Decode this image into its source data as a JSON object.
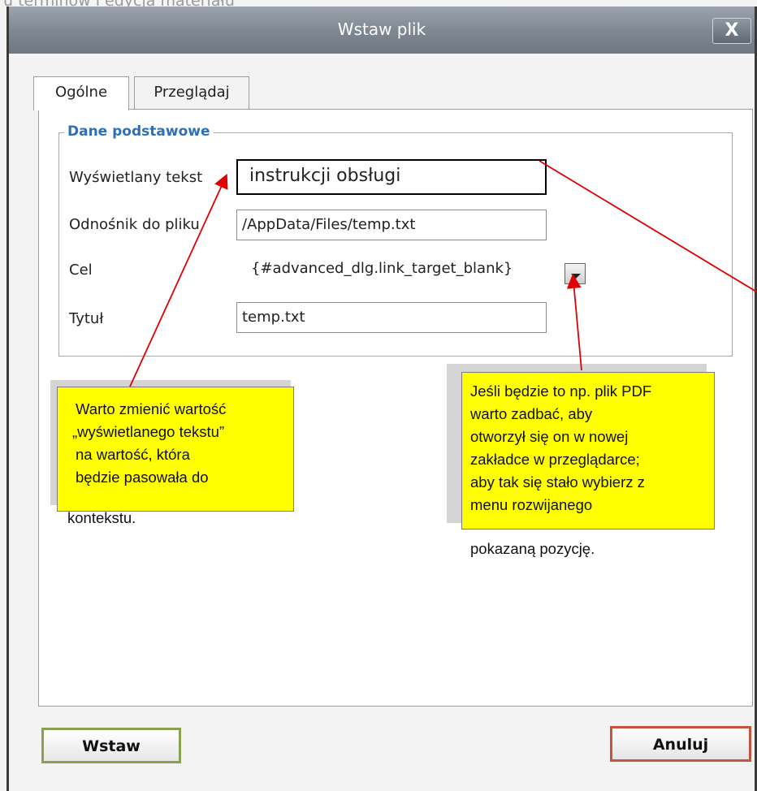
{
  "background": {
    "text": "u terminów i edycja materiału"
  },
  "dialog": {
    "title": "Wstaw plik",
    "close_label": "X",
    "tabs": [
      {
        "label": "Ogólne"
      },
      {
        "label": "Przeglądaj"
      }
    ],
    "fieldset": {
      "legend": "Dane podstawowe",
      "fields": {
        "display_text": {
          "label": "Wyświetlany tekst",
          "value": "instrukcji obsługi"
        },
        "file_link": {
          "label": "Odnośnik do pliku",
          "value": "/AppData/Files/temp.txt"
        },
        "target": {
          "label": "Cel",
          "value": "{#advanced_dlg.link_target_blank}"
        },
        "title": {
          "label": "Tytuł",
          "value": "temp.txt"
        }
      }
    },
    "buttons": {
      "insert": "Wstaw",
      "cancel": "Anuluj"
    }
  },
  "annotations": {
    "left_note": [
      "Warto zmienić wartość",
      "„wyświetlanego tekstu”",
      "na wartość, która",
      "będzie pasowała do",
      "kontekstu."
    ],
    "right_note": [
      "Jeśli będzie to np. plik PDF",
      "warto zadbać, aby",
      "otworzył się on w nowej",
      "zakładce w przeglądarce;",
      "aby tak się stało wybierz z",
      "menu rozwijanego",
      "pokazaną pozycję."
    ]
  },
  "colors": {
    "legend": "#2f6fb7",
    "note": "#ffff00",
    "arrow": "#e00000"
  }
}
